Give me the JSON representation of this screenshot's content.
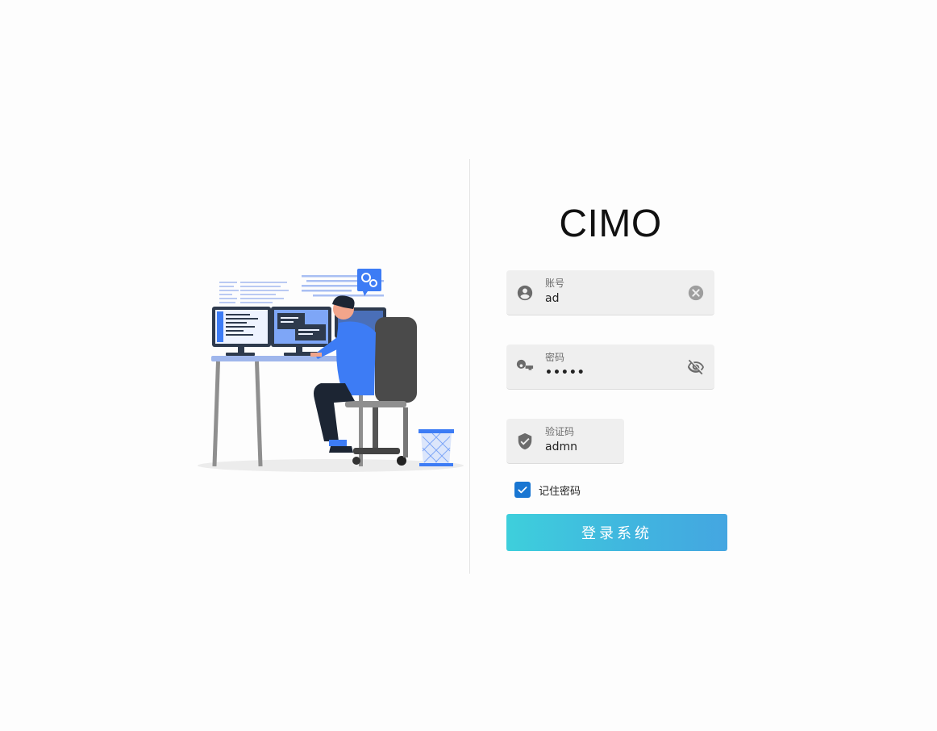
{
  "brand": {
    "title": "CIMO"
  },
  "form": {
    "account": {
      "label": "账号",
      "value": "ad",
      "lead_icon": "account-circle-icon",
      "trail_icon": "clear-icon"
    },
    "password": {
      "label": "密码",
      "value": "•••••",
      "lead_icon": "key-icon",
      "trail_icon": "eye-off-icon"
    },
    "captcha": {
      "label": "验证码",
      "value": "admn",
      "lead_icon": "shield-check-icon"
    },
    "remember": {
      "label": "记住密码",
      "checked": true
    },
    "submit_label": "登录系统"
  },
  "colors": {
    "accent": "#1976d2",
    "button_gradient_start": "#3ecfdc",
    "button_gradient_end": "#44a6e1",
    "illustration_blue": "#3d7cf5"
  }
}
